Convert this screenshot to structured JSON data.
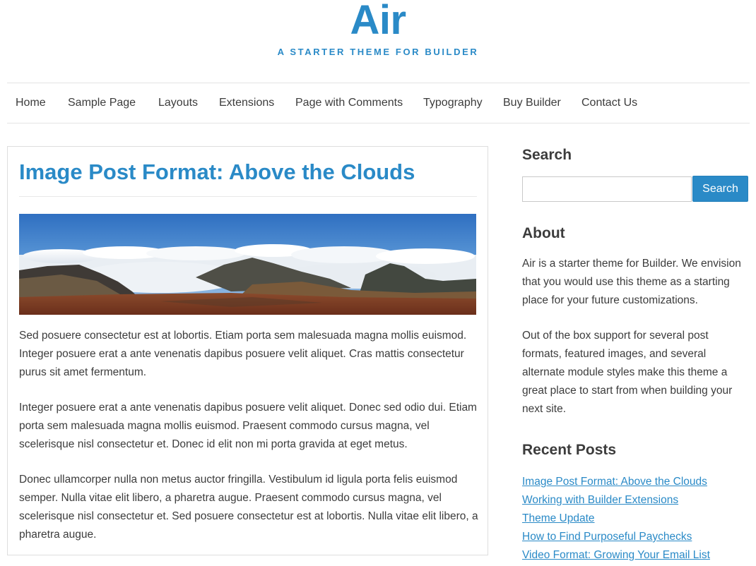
{
  "site": {
    "title": "Air",
    "tagline": "A STARTER THEME FOR BUILDER"
  },
  "nav": {
    "items": [
      {
        "label": "Home"
      },
      {
        "label": "Sample Page"
      },
      {
        "label": "Layouts"
      },
      {
        "label": "Extensions"
      },
      {
        "label": "Page with Comments"
      },
      {
        "label": "Typography"
      },
      {
        "label": "Buy Builder"
      },
      {
        "label": "Contact Us"
      }
    ]
  },
  "post": {
    "title": "Image Post Format: Above the Clouds",
    "paragraphs": [
      "Sed posuere consectetur est at lobortis. Etiam porta sem malesuada magna mollis euismod. Integer posuere erat a ante venenatis dapibus posuere velit aliquet. Cras mattis consectetur purus sit amet fermentum.",
      "Integer posuere erat a ante venenatis dapibus posuere velit aliquet. Donec sed odio dui. Etiam porta sem malesuada magna mollis euismod. Praesent commodo cursus magna, vel scelerisque nisl consectetur et. Donec id elit non mi porta gravida at eget metus.",
      "Donec ullamcorper nulla non metus auctor fringilla. Vestibulum id ligula porta felis euismod semper. Nulla vitae elit libero, a pharetra augue. Praesent commodo cursus magna, vel scelerisque nisl consectetur et. Sed posuere consectetur est at lobortis. Nulla vitae elit libero, a pharetra augue."
    ]
  },
  "sidebar": {
    "search": {
      "title": "Search",
      "input_value": "",
      "button_label": "Search"
    },
    "about": {
      "title": "About",
      "paragraphs": [
        "Air is a starter theme for Builder. We envision that you would use this theme as a starting place for your future customizations.",
        "Out of the box support for several post formats, featured images, and several alternate module styles make this theme a great place to start from when building your next site."
      ]
    },
    "recent_posts": {
      "title": "Recent Posts",
      "items": [
        {
          "label": "Image Post Format: Above the Clouds"
        },
        {
          "label": "Working with Builder Extensions"
        },
        {
          "label": "Theme Update"
        },
        {
          "label": "How to Find Purposeful Paychecks"
        },
        {
          "label": "Video Format: Growing Your Email List"
        }
      ]
    }
  },
  "colors": {
    "accent": "#2a8ac7",
    "text": "#3c3c3c",
    "border": "#dedede"
  }
}
